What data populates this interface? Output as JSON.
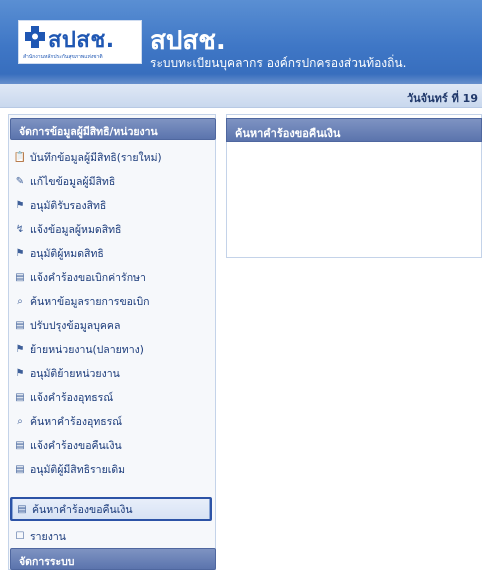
{
  "header": {
    "logo_text": "สปสช.",
    "logo_subtitle": "สำนักงานหลักประกันสุขภาพแห่งชาติ",
    "brand_title": "สปสช.",
    "brand_subtitle": "ระบบทะเบียนบุคลากร องค์กรปกครองส่วนท้องถิ่น."
  },
  "date_strip": {
    "text": "วันจันทร์ ที่ 19"
  },
  "sidebar": {
    "section1_title": "จัดการข้อมูลผู้มีสิทธิ/หน่วยงาน",
    "items": [
      {
        "icon": "📋",
        "icon_name": "list-icon",
        "label": "บันทึกข้อมูลผู้มีสิทธิ(รายใหม่)"
      },
      {
        "icon": "✎",
        "icon_name": "pen-icon",
        "label": "แก้ไขข้อมูลผู้มีสิทธิ"
      },
      {
        "icon": "⚑",
        "icon_name": "flag-icon",
        "label": "อนุมัติรับรองสิทธิ"
      },
      {
        "icon": "↯",
        "icon_name": "arrow-icon",
        "label": "แจ้งข้อมูลผู้หมดสิทธิ"
      },
      {
        "icon": "⚑",
        "icon_name": "flag-icon",
        "label": "อนุมัติผู้หมดสิทธิ"
      },
      {
        "icon": "▤",
        "icon_name": "form-icon",
        "label": "แจ้งคำร้องขอเบิกค่ารักษา"
      },
      {
        "icon": "⌕",
        "icon_name": "search-icon",
        "label": "ค้นหาข้อมูลรายการขอเบิก"
      },
      {
        "icon": "▤",
        "icon_name": "form-icon",
        "label": "ปรับปรุงข้อมูลบุคคล"
      },
      {
        "icon": "⚑",
        "icon_name": "flag-icon",
        "label": "ย้ายหน่วยงาน(ปลายทาง)"
      },
      {
        "icon": "⚑",
        "icon_name": "flag-icon",
        "label": "อนุมัติย้ายหน่วยงาน"
      },
      {
        "icon": "▤",
        "icon_name": "form-icon",
        "label": "แจ้งคำร้องอุทธรณ์"
      },
      {
        "icon": "⌕",
        "icon_name": "search-icon",
        "label": "ค้นหาคำร้องอุทธรณ์"
      },
      {
        "icon": "▤",
        "icon_name": "form-icon",
        "label": "แจ้งคำร้องขอคืนเงิน"
      },
      {
        "icon": "▤",
        "icon_name": "form-icon",
        "label": "อนุมัติผู้มีสิทธิรายเดิม"
      },
      {
        "icon": "▤",
        "icon_name": "form-icon",
        "label": "ค้นหาคำร้องขอคืนเงิน"
      },
      {
        "icon": "☐",
        "icon_name": "report-icon",
        "label": "รายงาน"
      }
    ],
    "section2_title": "จัดการระบบ"
  },
  "main": {
    "panel_title": "ค้นหาคำร้องขอคืนเงิน"
  },
  "colors": {
    "banner": "#3f77c6",
    "section_header": "#5b74ad",
    "menu_text": "#1a3a7a",
    "active_border": "#2c53a6"
  }
}
